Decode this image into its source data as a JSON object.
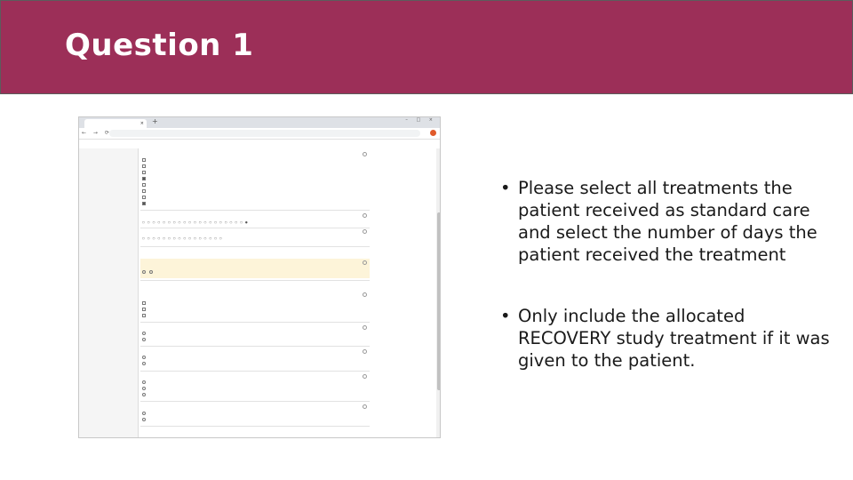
{
  "slide": {
    "title": "Question 1",
    "bullets": [
      "Please select all treatments the patient received as standard care and select the number of days the patient received the treatment",
      "Only include the allocated RECOVERY study treatment if it was given to the patient."
    ]
  },
  "colors": {
    "title_bar": "#9c2f58",
    "title_text": "#ffffff",
    "body_text": "#1a1a1a"
  }
}
